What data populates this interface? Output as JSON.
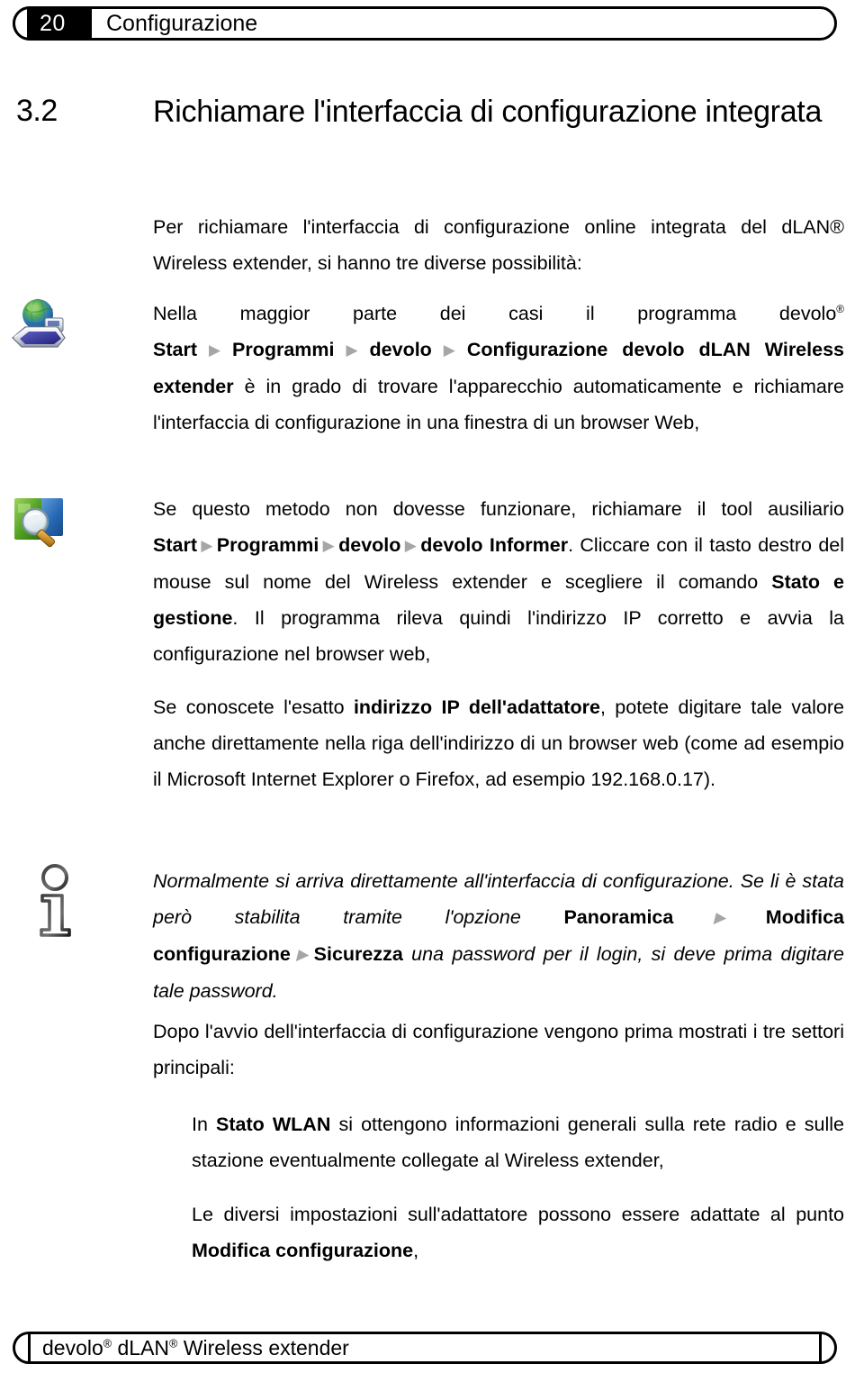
{
  "header": {
    "page_number": "20",
    "title": "Configurazione"
  },
  "footer": {
    "brand": "devolo",
    "reg1": "®",
    "product": "dLAN",
    "reg2": "®",
    "suffix": "Wireless extender",
    "full_text": "devolo® dLAN® Wireless extender"
  },
  "section": {
    "number": "3.2",
    "title": "Richiamare l'interfaccia di configurazione integrata",
    "intro": "Per richiamare l'interfaccia di configurazione online integrata del dLAN® Wireless extender, si hanno tre diverse possibilità:"
  },
  "arrow_glyph": "▶",
  "arrow_color": "#a6a6a6",
  "blocks": [
    {
      "icon": "globe-network-icon",
      "parts": [
        {
          "t": "Nella maggior parte dei casi il programma devolo",
          "s": "normal"
        },
        {
          "t": "®",
          "s": "sup"
        },
        {
          "t": " ",
          "s": "normal"
        },
        {
          "t": "Start",
          "s": "bold"
        },
        {
          "t": "▶",
          "s": "arrow"
        },
        {
          "t": "Programmi",
          "s": "bold"
        },
        {
          "t": "▶",
          "s": "arrow"
        },
        {
          "t": "devolo",
          "s": "bold"
        },
        {
          "t": "▶",
          "s": "arrow"
        },
        {
          "t": "Configurazione devolo dLAN Wireless extender",
          "s": "bold"
        },
        {
          "t": " è in grado di trovare l'apparecchio automaticamente e richiamare l'interfaccia di configurazione in una finestra di un browser Web,",
          "s": "normal"
        }
      ]
    },
    {
      "icon": "informer-magnifier-icon",
      "parts": [
        {
          "t": "Se questo metodo non dovesse funzionare, richiamare il tool ausiliario ",
          "s": "normal"
        },
        {
          "t": "Start",
          "s": "bold"
        },
        {
          "t": "▶",
          "s": "arrow"
        },
        {
          "t": "Programmi",
          "s": "bold"
        },
        {
          "t": "▶",
          "s": "arrow"
        },
        {
          "t": "devolo",
          "s": "bold"
        },
        {
          "t": "▶",
          "s": "arrow"
        },
        {
          "t": "devolo Informer",
          "s": "bold"
        },
        {
          "t": ". Cliccare con il tasto destro del mouse sul nome del Wireless extender e scegliere il comando ",
          "s": "normal"
        },
        {
          "t": "Stato e gestione",
          "s": "bold"
        },
        {
          "t": ". Il programma rileva quindi l'indirizzo IP corretto e avvia la configurazione nel browser web,",
          "s": "normal"
        }
      ]
    },
    {
      "icon": "",
      "parts": [
        {
          "t": "Se conoscete l'esatto ",
          "s": "normal"
        },
        {
          "t": "indirizzo IP dell'adattatore",
          "s": "bold"
        },
        {
          "t": ", potete digitare tale valore anche direttamente nella riga dell'indirizzo di un browser web (come ad esempio il Microsoft Internet Explorer o Firefox, ad esempio 192.168.0.17).",
          "s": "normal"
        }
      ]
    }
  ],
  "note": {
    "icon": "info-i-icon",
    "parts": [
      {
        "t": "Normalmente si arriva direttamente all'interfaccia di configurazione. Se li è stata però stabilita tramite l'opzione ",
        "s": "italic"
      },
      {
        "t": "Panoramica",
        "s": "bold"
      },
      {
        "t": "▶",
        "s": "arrow"
      },
      {
        "t": "Modifica configurazione",
        "s": "bold"
      },
      {
        "t": "▶",
        "s": "arrow"
      },
      {
        "t": "Sicurezza",
        "s": "bold"
      },
      {
        "t": " una password per il login, si deve prima digitare tale password.",
        "s": "italic"
      }
    ]
  },
  "closing": {
    "lead": "Dopo l'avvio dell'interfaccia di configurazione vengono prima mostrati i tre settori principali:",
    "items": [
      {
        "parts": [
          {
            "t": "In ",
            "s": "normal"
          },
          {
            "t": "Stato WLAN",
            "s": "bold"
          },
          {
            "t": " si ottengono informazioni generali sulla rete radio e sulle stazione eventualmente collegate al Wireless extender,",
            "s": "normal"
          }
        ]
      },
      {
        "parts": [
          {
            "t": "Le diversi impostazioni sull'adattatore possono essere adattate al punto ",
            "s": "normal"
          },
          {
            "t": "Modifica configurazione",
            "s": "bold"
          },
          {
            "t": ",",
            "s": "normal"
          }
        ]
      }
    ]
  },
  "colors": {
    "text": "#000000",
    "page_bg": "#ffffff",
    "arrow": "#a6a6a6",
    "header_block": "#000000"
  }
}
